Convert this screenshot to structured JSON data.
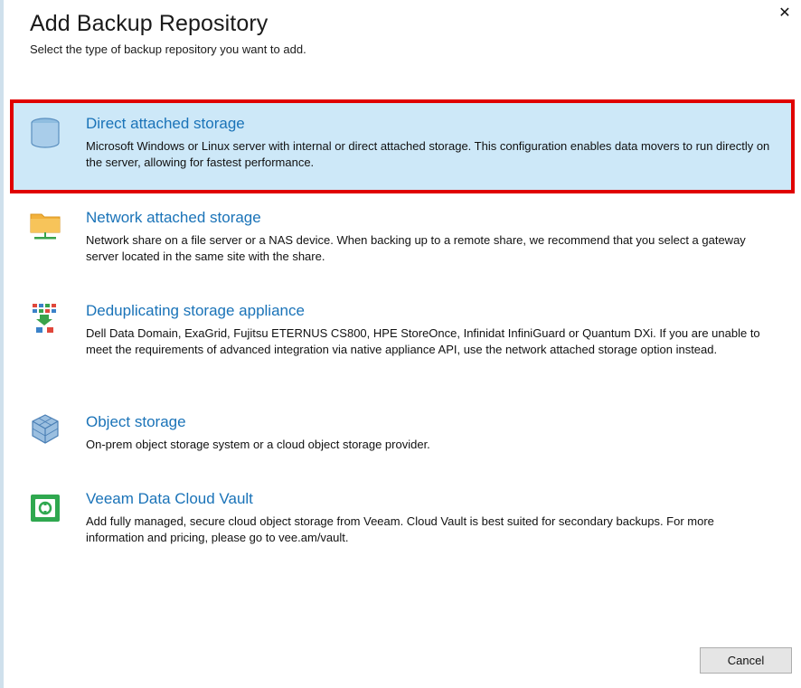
{
  "dialog": {
    "title": "Add Backup Repository",
    "subtitle": "Select the type of backup repository you want to add."
  },
  "close_icon": "close-icon",
  "options": [
    {
      "title": "Direct attached storage",
      "description": "Microsoft Windows or Linux server with internal or direct attached storage. This configuration enables data movers to run directly on the server, allowing for fastest performance.",
      "icon": "database-icon",
      "selected": true
    },
    {
      "title": "Network attached storage",
      "description": "Network share on a file server or a NAS device. When backing up to a remote share, we recommend that you select a gateway server located in the same site with the share.",
      "icon": "network-folder-icon"
    },
    {
      "title": "Deduplicating storage appliance",
      "description": "Dell Data Domain, ExaGrid, Fujitsu ETERNUS CS800, HPE StoreOnce, Infinidat InfiniGuard or Quantum DXi. If you are unable to meet the requirements of advanced integration via native appliance API, use the network attached storage option instead.",
      "icon": "deduplication-icon"
    },
    {
      "title": "Object storage",
      "description": "On-prem object storage system or a cloud object storage provider.",
      "icon": "object-storage-icon"
    },
    {
      "title": "Veeam Data Cloud Vault",
      "description": "Add fully managed, secure cloud object storage from Veeam. Cloud Vault is best suited for secondary backups. For more information and pricing, please go to vee.am/vault.",
      "icon": "cloud-vault-icon"
    }
  ],
  "footer": {
    "cancel_label": "Cancel"
  },
  "colors": {
    "link_blue": "#1a73b8",
    "selected_bg": "#cde8f8",
    "highlight_red": "#e00000"
  }
}
